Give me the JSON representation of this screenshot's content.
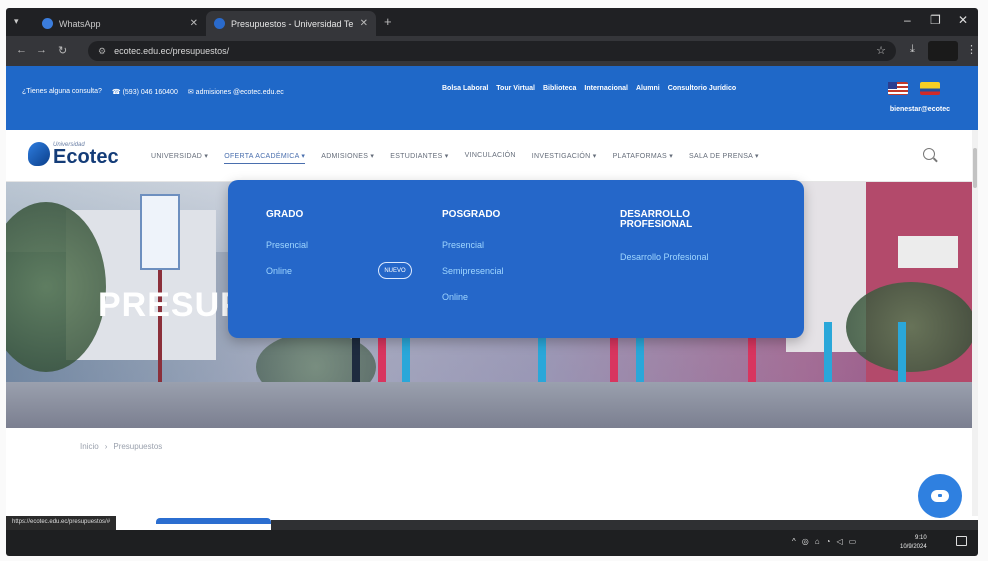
{
  "browser": {
    "tabs": [
      {
        "title": "WhatsApp",
        "favicon_color": "#3b7ddd"
      },
      {
        "title": "Presupuestos - Universidad Te",
        "favicon_color": "#2a6acb"
      }
    ],
    "url": "ecotec.edu.ec/presupuestos/",
    "status_url": "https://ecotec.edu.ec/presupuestos/#"
  },
  "topbar": {
    "question": "¿Tienes alguna consulta?",
    "phone": "(593) 046 160400",
    "email": "admisiones @ecotec.edu.ec",
    "links": [
      "Bolsa Laboral",
      "Tour Virtual",
      "Biblioteca",
      "Internacional",
      "Alumni",
      "Consultorio Jurídico"
    ],
    "links2": "bienestar@ecotec"
  },
  "nav": {
    "logo_small": "Universidad",
    "logo_name": "Ecotec",
    "items": [
      "UNIVERSIDAD ▾",
      "OFERTA ACADÉMICA ▾",
      "ADMISIONES ▾",
      "ESTUDIANTES ▾",
      "VINCULACIÓN",
      "INVESTIGACIÓN ▾",
      "PLATAFORMAS ▾",
      "SALA DE PRENSA ▾"
    ]
  },
  "mega_menu": {
    "grado": {
      "heading": "GRADO",
      "links": [
        "Presencial",
        "Online"
      ],
      "badge": "NUEVO"
    },
    "posgrado": {
      "heading": "POSGRADO",
      "links": [
        "Presencial",
        "Semipresencial",
        "Online"
      ]
    },
    "desarrollo": {
      "heading": "DESARROLLO PROFESIONAL",
      "links": [
        "Desarrollo Profesional"
      ]
    }
  },
  "hero": {
    "title": "PRESUP"
  },
  "breadcrumb": {
    "home": "Inicio",
    "separator": "›",
    "current": "Presupuestos"
  },
  "taskbar": {
    "time": "9:10",
    "date": "10/9/2024"
  },
  "colors": {
    "brand_blue": "#1f68c8",
    "menu_blue": "#2567c9",
    "link_light_blue": "#9fd6ff"
  }
}
